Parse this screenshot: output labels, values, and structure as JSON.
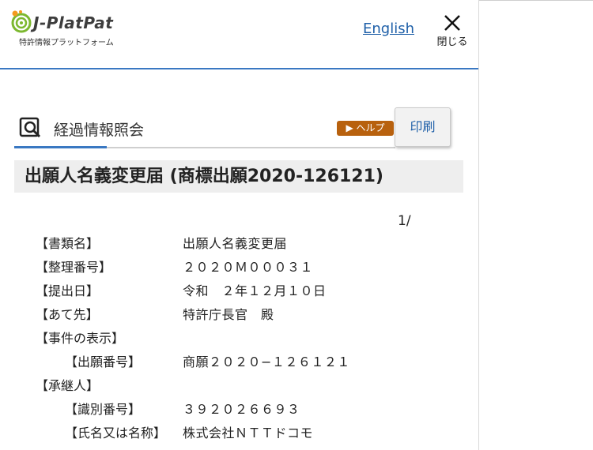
{
  "header": {
    "logo_title": "J-PlatPat",
    "logo_subtitle": "特許情報プラットフォーム",
    "language_link": "English",
    "close_label": "閉じる"
  },
  "toolbar": {
    "tab_title": "経過情報照会",
    "help_label": "▶ ヘルプ",
    "print_label": "印刷"
  },
  "document": {
    "heading": "出願人名義変更届 (商標出願2020-126121)",
    "page_number": "1/",
    "rows": [
      {
        "label": "【書類名】",
        "value": "出願人名義変更届"
      },
      {
        "label": "【整理番号】",
        "value": "２０２０Ｍ０００３１"
      },
      {
        "label": "【提出日】",
        "value": "令和　２年１２月１０日"
      },
      {
        "label": "【あて先】",
        "value": "特許庁長官　殿"
      },
      {
        "label": "【事件の表示】",
        "value": ""
      },
      {
        "label": "【出願番号】",
        "value": "商願２０２０−１２６１２１"
      },
      {
        "label": "【承継人】",
        "value": ""
      },
      {
        "label": "【識別番号】",
        "value": "３９２０２６６９３"
      },
      {
        "label": "【氏名又は名称】",
        "value": "株式会社ＮＴＴドコモ"
      }
    ]
  },
  "colors": {
    "accent_blue": "#3a78c2",
    "link_blue": "#1e5fa8",
    "help_orange": "#b8610e",
    "logo_green": "#7cb82f",
    "logo_orange": "#f39a1e"
  }
}
